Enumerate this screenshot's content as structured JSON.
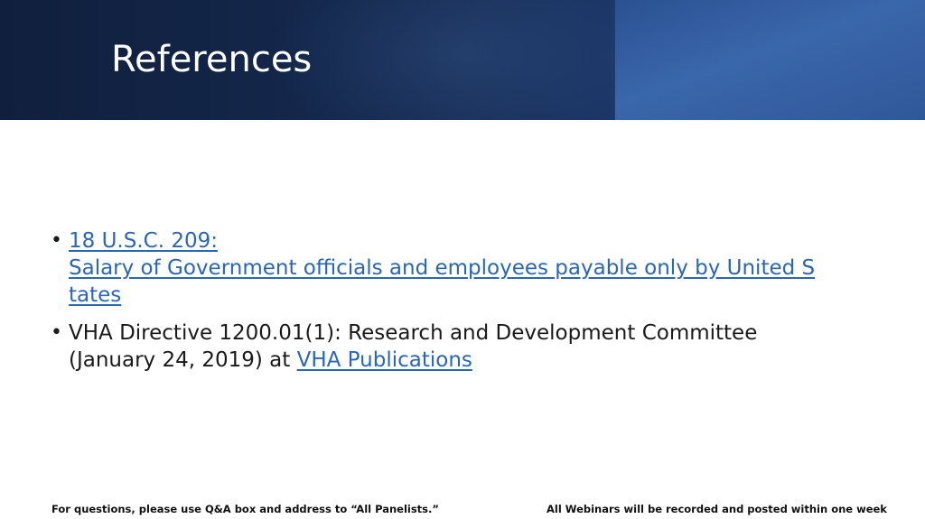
{
  "slide": {
    "title": "References"
  },
  "references": [
    {
      "link_line1": "18 U.S.C. 209: ",
      "link_line2": "Salary of Government officials and employees payable only by United S",
      "link_line3": "tates"
    },
    {
      "text_line1": "VHA Directive 1200.01(1): Research and Development Committee",
      "text_line2_prefix": "(January 24, 2019) at ",
      "link_text": "VHA Publications"
    }
  ],
  "bullet_symbol": "•",
  "footer": {
    "left": "For questions, please use Q&A box and address to “All Panelists.”",
    "right": "All Webinars will be recorded and posted within one week"
  },
  "colors": {
    "header_dark": "#101f3d",
    "header_accent": "#3a66ab",
    "link": "#2a66b4",
    "text": "#1a1a1a"
  }
}
